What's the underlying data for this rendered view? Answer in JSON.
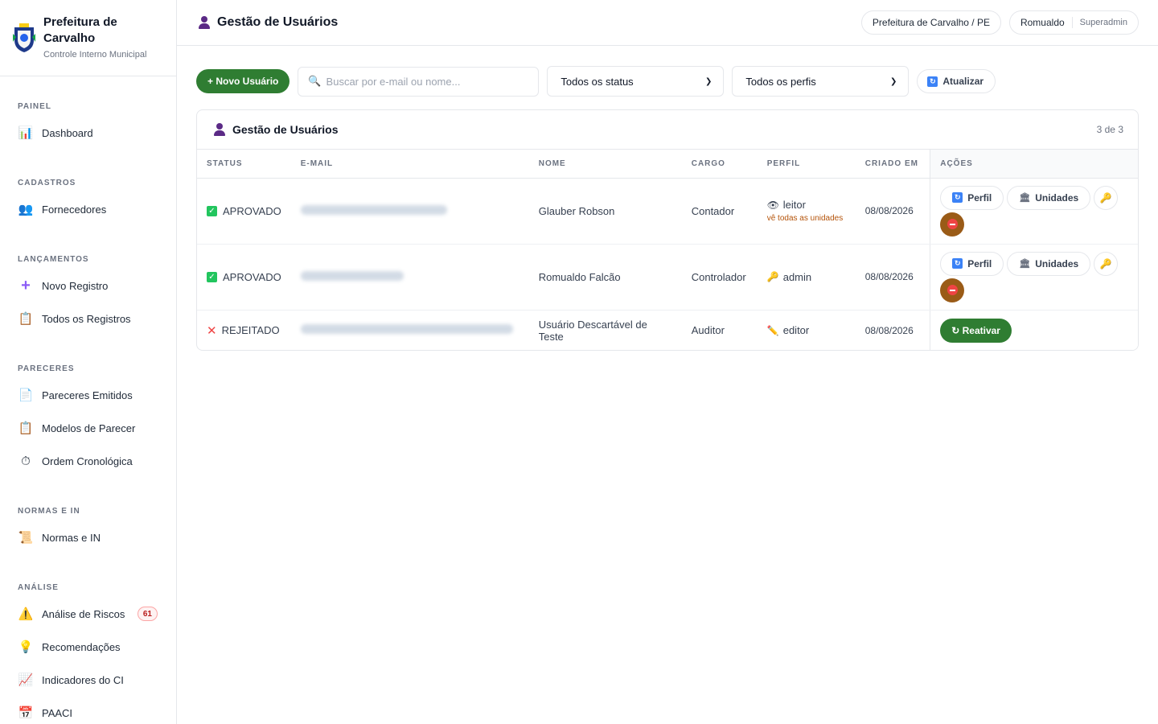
{
  "brand": {
    "title": "Prefeitura de Carvalho",
    "subtitle": "Controle Interno Municipal"
  },
  "sidebar": {
    "sections": [
      {
        "title": "PAINEL",
        "items": [
          {
            "label": "Dashboard",
            "icon": "bar-chart-icon"
          }
        ]
      },
      {
        "title": "CADASTROS",
        "items": [
          {
            "label": "Fornecedores",
            "icon": "people-icon"
          }
        ]
      },
      {
        "title": "LANÇAMENTOS",
        "items": [
          {
            "label": "Novo Registro",
            "icon": "plus-icon"
          },
          {
            "label": "Todos os Registros",
            "icon": "clipboard-icon"
          }
        ]
      },
      {
        "title": "PARECERES",
        "items": [
          {
            "label": "Pareceres Emitidos",
            "icon": "document-icon"
          },
          {
            "label": "Modelos de Parecer",
            "icon": "clipboard-icon"
          },
          {
            "label": "Ordem Cronológica",
            "icon": "stopwatch-icon"
          }
        ]
      },
      {
        "title": "NORMAS E IN",
        "items": [
          {
            "label": "Normas e IN",
            "icon": "scroll-icon"
          }
        ]
      },
      {
        "title": "ANÁLISE",
        "items": [
          {
            "label": "Análise de Riscos",
            "icon": "warning-icon",
            "badge": "61"
          },
          {
            "label": "Recomendações",
            "icon": "lightbulb-icon"
          },
          {
            "label": "Indicadores do CI",
            "icon": "line-chart-icon"
          },
          {
            "label": "PAACI",
            "icon": "calendar-icon"
          }
        ]
      }
    ]
  },
  "header": {
    "title": "Gestão de Usuários",
    "org": "Prefeitura de Carvalho / PE",
    "user": "Romualdo",
    "role": "Superadmin"
  },
  "toolbar": {
    "new_user": "+ Novo Usuário",
    "search_placeholder": "Buscar por e-mail ou nome...",
    "status_filter": "Todos os status",
    "profile_filter": "Todos os perfis",
    "refresh": "Atualizar"
  },
  "table": {
    "title": "Gestão de Usuários",
    "count": "3 de 3",
    "columns": [
      "STATUS",
      "E-MAIL",
      "NOME",
      "CARGO",
      "PERFIL",
      "CRIADO EM",
      "AÇÕES"
    ],
    "rows": [
      {
        "status": "APROVADO",
        "status_icon": "check-icon",
        "name": "Glauber Robson",
        "cargo": "Contador",
        "perfil": "leitor",
        "perfil_icon": "eye-icon",
        "perfil_note": "vê todas as unidades",
        "created": "08/08/2026"
      },
      {
        "status": "APROVADO",
        "status_icon": "check-icon",
        "name": "Romualdo Falcão",
        "cargo": "Controlador",
        "perfil": "admin",
        "perfil_icon": "key-icon",
        "created": "08/08/2026"
      },
      {
        "status": "REJEITADO",
        "status_icon": "x-icon",
        "name": "Usuário Descartável de Teste",
        "cargo": "Auditor",
        "perfil": "editor",
        "perfil_icon": "pencil-icon",
        "created": "08/08/2026"
      }
    ],
    "actions": {
      "profile": "Perfil",
      "units": "Unidades",
      "reactivate": "↻ Reativar"
    }
  },
  "colors": {
    "accent_green": "#2f7d32",
    "block_brown": "#9a5b17",
    "badge_red": "#b91c1c",
    "title_purple": "#5b2a86"
  }
}
